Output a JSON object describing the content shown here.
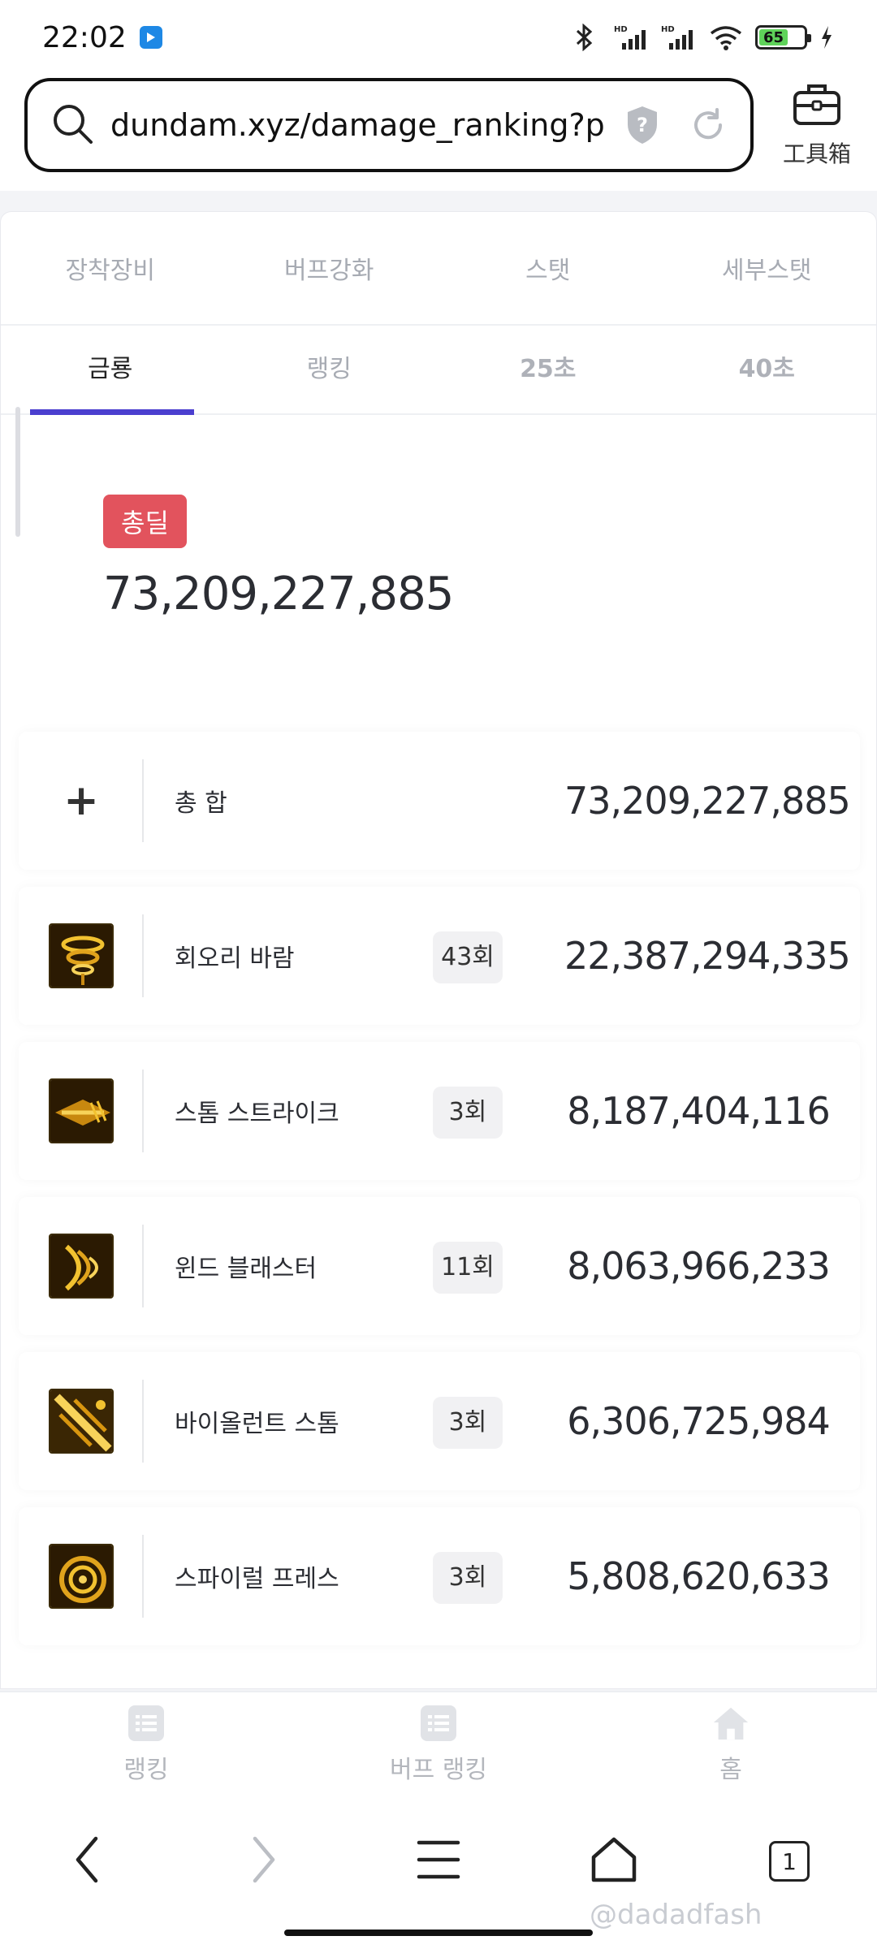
{
  "status_bar": {
    "time": "22:02",
    "battery_level": "65",
    "icons": [
      "bluetooth-icon",
      "signal-hd-icon",
      "signal-hd-icon",
      "wifi-icon",
      "battery-icon",
      "charging-icon"
    ]
  },
  "browser": {
    "url": "dundam.xyz/damage_ranking?pa…",
    "toolbox_label": "工具箱",
    "tab_count": "1"
  },
  "tabs_top": [
    "장착장비",
    "버프강화",
    "스탯",
    "세부스탯"
  ],
  "tabs_sub": [
    "금룡",
    "랭킹",
    "25초",
    "40초"
  ],
  "total": {
    "badge": "총딜",
    "value": "73,209,227,885"
  },
  "rows": [
    {
      "name": "총 합",
      "count": "",
      "value": "73,209,227,885",
      "icon": "plus-icon"
    },
    {
      "name": "회오리 바람",
      "count": "43회",
      "value": "22,387,294,335",
      "icon": "whirlwind-skill-icon"
    },
    {
      "name": "스톰 스트라이크",
      "count": "3회",
      "value": "8,187,404,116",
      "icon": "storm-strike-skill-icon"
    },
    {
      "name": "윈드 블래스터",
      "count": "11회",
      "value": "8,063,966,233",
      "icon": "wind-blaster-skill-icon"
    },
    {
      "name": "바이올런트 스톰",
      "count": "3회",
      "value": "6,306,725,984",
      "icon": "violent-storm-skill-icon"
    },
    {
      "name": "스파이럴 프레스",
      "count": "3회",
      "value": "5,808,620,633",
      "icon": "spiral-press-skill-icon"
    }
  ],
  "site_nav": [
    "랭킹",
    "버프 랭킹",
    "홈"
  ],
  "watermark": "@dadadfash",
  "colors": {
    "accent_underline": "#4b3fcf",
    "badge_red": "#e2535d",
    "battery_green": "#5fd35a"
  }
}
